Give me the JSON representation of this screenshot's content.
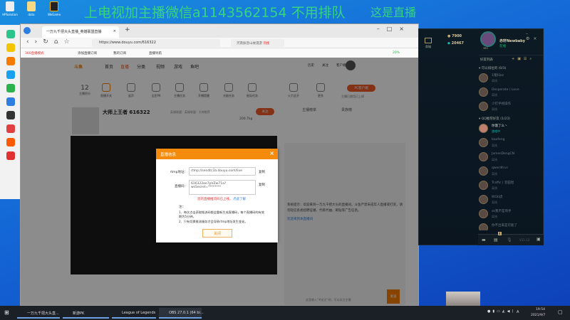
{
  "desktop": {
    "banner": "上电视加主播微信a1143562154 不用排队",
    "banner_right": "这是直播",
    "icons": [
      "HPSolution",
      "data",
      "WeGame"
    ]
  },
  "browser": {
    "tab_title": "一万九千把大头直播_英雄联盟直播",
    "url": "https://www.douyu.com/616322",
    "search_placeholder": "河南振晋山故漫游",
    "hot": "热搜",
    "bookmarks": [
      "360直播模式",
      "添加直播订阅",
      "我的订阅",
      "直播导航"
    ],
    "battery": "20%"
  },
  "douyu": {
    "nav": [
      "首页",
      "直播",
      "分类",
      "视频",
      "游戏",
      "鱼吧"
    ],
    "nav_right": [
      "历史",
      "关注",
      "客户端"
    ],
    "tools": [
      "主播积分",
      "直播开关",
      "鲨声",
      "全民PK",
      "主播任务",
      "开播提醒",
      "光能任务",
      "星际任务",
      "火力全开",
      "更多"
    ],
    "score": "12",
    "pc_client": "PC客户端",
    "pc_client_sub": "主播已使用已上线",
    "streamer_name": "大师上王者 616322",
    "tags": "英雄联盟 · 英雄联盟 · 大神推荐",
    "follow": "关注",
    "weight": "200.7kg",
    "rank": "主播榜单",
    "fans": "贵族榜",
    "chat_notice": "系统提示：欢迎来到一万九千把大头的直播间。斗鱼严禁未成年人直播或打赏，请勿轻信各类招聘征婚、代练代抽、刷钻等广告信息。",
    "chat_welcome": "欢迎来到本直播间",
    "chat_input_placeholder": "这里输入“#关注”吧，可以关注主播",
    "send": "发送"
  },
  "modal": {
    "title": "直播信息",
    "rtmp_label": "rtmp地址：",
    "rtmp_value": "rtmp://sendtc3a.douyu.com/live",
    "code_label": "直播码：",
    "code_value": "616322oe7pVZw71a?wsSecret=********",
    "copy": "复制",
    "warning": "您的直播推流码已上线。",
    "learn_more": "点此了解",
    "note_title": "注：",
    "note1": "1、每次点击获取推流码都会重新生成直播码，每个直播码的有效期为5分钟。",
    "note2": "2、只有切换推流服务才会导致rtmp地址发生变化。",
    "close": "关闭"
  },
  "lol": {
    "store": "商城",
    "rp": "7900",
    "be": "20467",
    "username": "赤轩Newbaby",
    "status": "在线",
    "level": "383",
    "friends_title": "好友列表",
    "group1": "可以排位的 (0/3)",
    "group2": "QQ推荐好友 (1/23)",
    "friends1": [
      {
        "name": "1猪扫ez",
        "status": "离线"
      },
      {
        "name": "Desperate丨Love",
        "status": "离线"
      },
      {
        "name": "少打手残操作",
        "status": "离线"
      }
    ],
    "friends2": [
      {
        "name": "你饿了么丶",
        "status": "游戏中"
      },
      {
        "name": "baofeng",
        "status": "离线"
      },
      {
        "name": "JamesDengCN",
        "status": "离线"
      },
      {
        "name": "qwerdfcvc",
        "status": "离线"
      },
      {
        "name": "Traffic丨羽田智",
        "status": "离线"
      },
      {
        "name": "WGti虎",
        "status": "离线"
      },
      {
        "name": "sk我不是哥手",
        "status": "离线"
      },
      {
        "name": "你不出来是可能了",
        "status": "离线"
      }
    ],
    "badge": "4",
    "version": "V11.13"
  },
  "taskbar": {
    "items": [
      "一万九千把大头直...",
      "新游PK",
      "League of Legends",
      "OBS 27.0.1 (64 bi..."
    ],
    "time": "19:54",
    "date": "2021/9/7",
    "ime": "A"
  }
}
